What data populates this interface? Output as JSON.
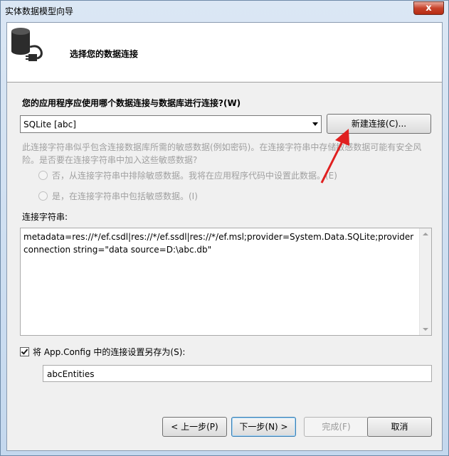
{
  "window": {
    "title": "实体数据模型向导",
    "close_label": "x"
  },
  "header": {
    "title": "选择您的数据连接",
    "icon": "database-plug-icon"
  },
  "connection": {
    "question": "您的应用程序应使用哪个数据连接与数据库进行连接?(W)",
    "selected": "SQLite [abc]",
    "new_connection_label": "新建连接(C)..."
  },
  "sensitive": {
    "description": "此连接字符串似乎包含连接数据库所需的敏感数据(例如密码)。在连接字符串中存储敏感数据可能有安全风险。是否要在连接字符串中加入这些敏感数据?",
    "option_exclude": "否，从连接字符串中排除敏感数据。我将在应用程序代码中设置此数据。(E)",
    "option_include": "是，在连接字符串中包括敏感数据。(I)"
  },
  "connection_string": {
    "label": "连接字符串:",
    "value": "metadata=res://*/ef.csdl|res://*/ef.ssdl|res://*/ef.msl;provider=System.Data.SQLite;provider connection string=\"data source=D:\\abc.db\""
  },
  "save": {
    "checked": true,
    "label": "将 App.Config 中的连接设置另存为(S):",
    "name_value": "abcEntities"
  },
  "buttons": {
    "back": "< 上一步(P)",
    "next": "下一步(N) >",
    "finish": "完成(F)",
    "cancel": "取消"
  },
  "colors": {
    "annotation_arrow": "#e02020"
  }
}
